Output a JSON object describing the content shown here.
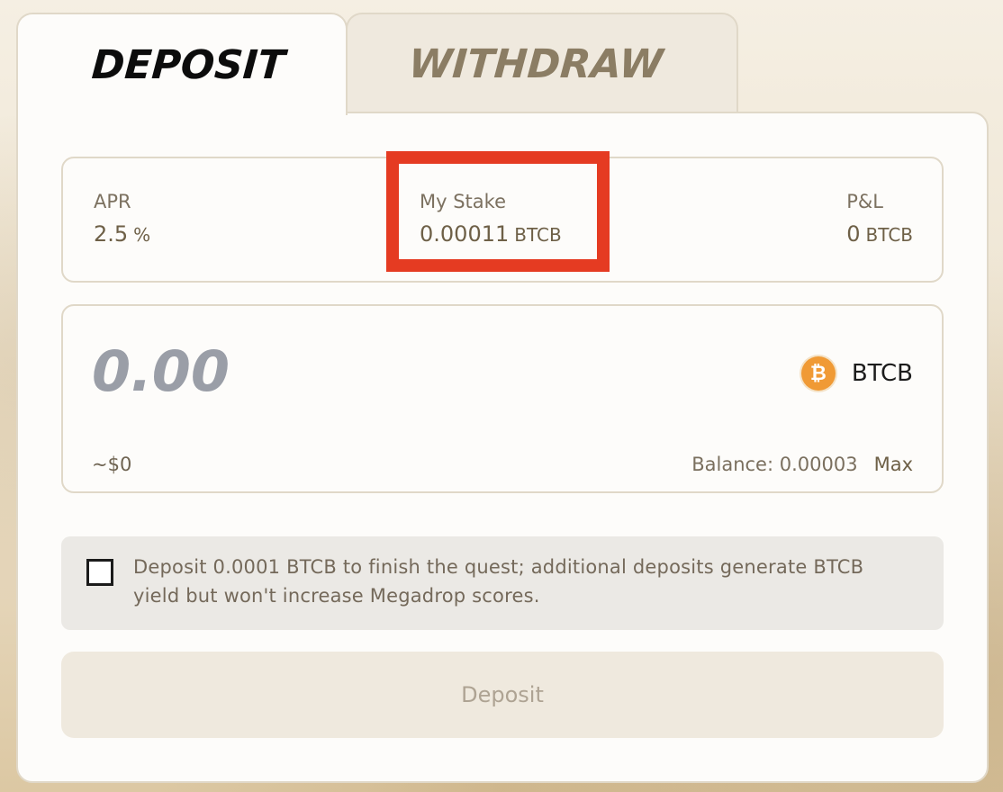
{
  "tabs": {
    "deposit": "DEPOSIT",
    "withdraw": "WITHDRAW"
  },
  "stats": {
    "apr": {
      "label": "APR",
      "value": "2.5",
      "unit": "%"
    },
    "my_stake": {
      "label": "My Stake",
      "value": "0.00011",
      "unit": "BTCB"
    },
    "pnl": {
      "label": "P&L",
      "value": "0",
      "unit": "BTCB"
    }
  },
  "amount": {
    "placeholder": "0.00",
    "token": "BTCB",
    "usd_value": "~$0",
    "balance_label": "Balance: 0.00003",
    "max_label": "Max"
  },
  "quest": {
    "checked": false,
    "text": "Deposit 0.0001 BTCB to finish the quest; additional deposits generate BTCB yield but won't increase Megadrop scores."
  },
  "actions": {
    "deposit_button": "Deposit"
  },
  "colors": {
    "highlight": "#e53b22",
    "btc_orange": "#f09a35"
  },
  "icons": {
    "token_icon": "bitcoin-icon",
    "checkbox_icon": "checkbox-icon"
  }
}
